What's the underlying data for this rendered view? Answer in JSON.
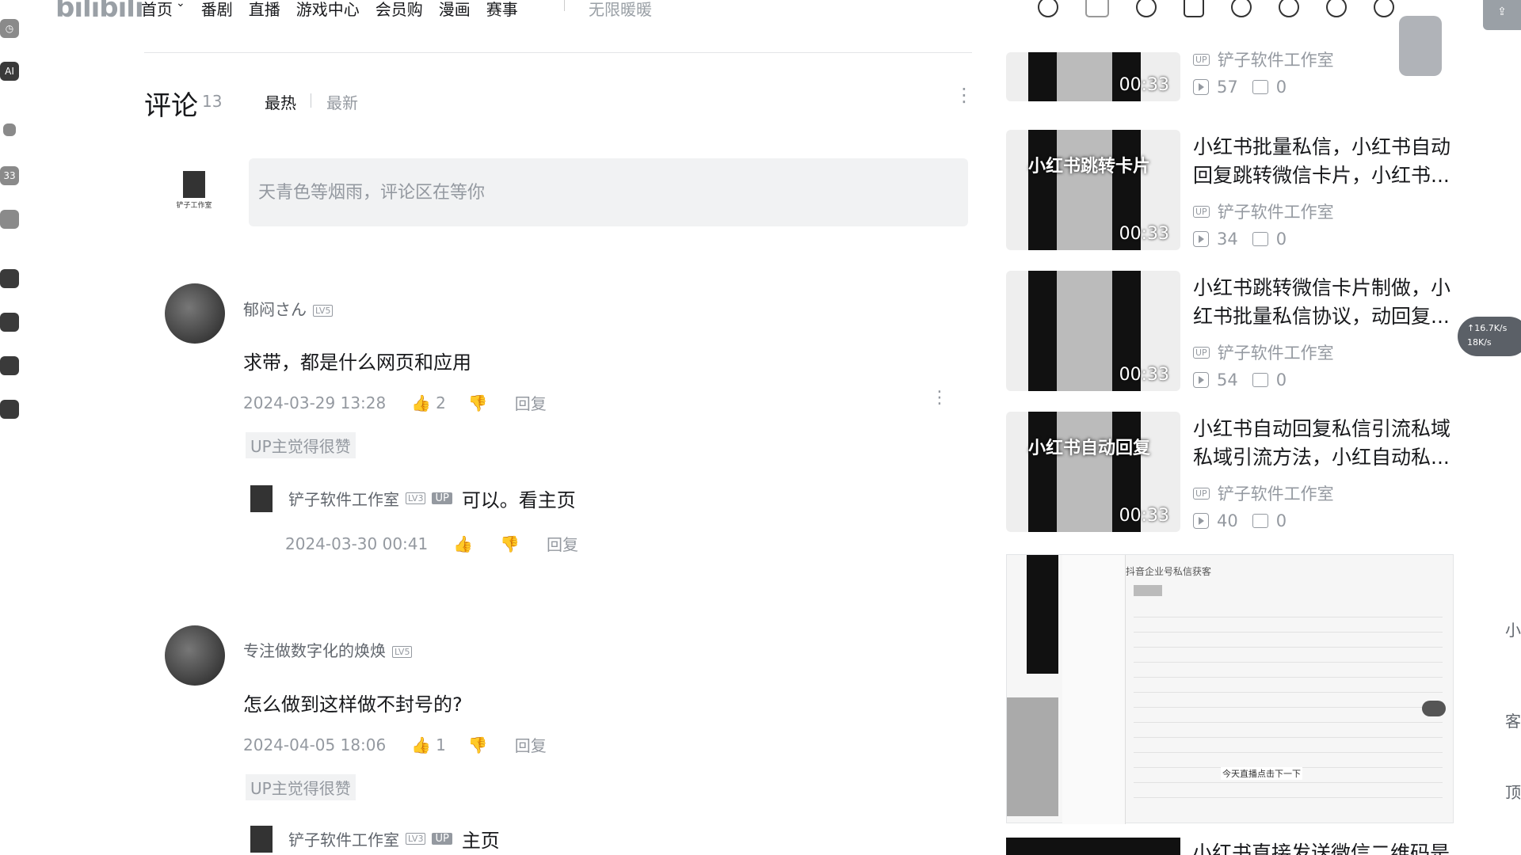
{
  "nav": {
    "logo": "bilibili",
    "items": [
      "首页",
      "番剧",
      "直播",
      "游戏中心",
      "会员购",
      "漫画",
      "赛事"
    ],
    "search_hint": "无限暖暖"
  },
  "left_strip": {
    "ai_label": "AI",
    "badge": "33"
  },
  "comments": {
    "title": "评论",
    "count": "13",
    "sort_hot": "最热",
    "sort_new": "最新",
    "input_placeholder": "天青色等烟雨，评论区在等你",
    "self_avatar_caption": "铲子工作室",
    "items": [
      {
        "user": "郁闷さん",
        "level": "LV5",
        "text": "求带，都是什么网页和应用",
        "time": "2024-03-29 13:28",
        "likes": "2",
        "reply_label": "回复",
        "up_liked": "UP主觉得很赞",
        "reply": {
          "user": "铲子软件工作室",
          "level": "LV3",
          "up": "UP",
          "text": "可以。看主页",
          "time": "2024-03-30 00:41",
          "reply_label": "回复"
        }
      },
      {
        "user": "专注做数字化的焕焕",
        "level": "LV5",
        "text": "怎么做到这样做不封号的?",
        "time": "2024-04-05 18:06",
        "likes": "1",
        "reply_label": "回复",
        "up_liked": "UP主觉得很赞",
        "reply": {
          "user": "铲子软件工作室",
          "level": "LV3",
          "up": "UP",
          "text": "主页"
        }
      }
    ]
  },
  "videos": [
    {
      "title": "",
      "author": "铲子软件工作室",
      "plays": "57",
      "danmaku": "0",
      "duration": "00:33",
      "overlay": ""
    },
    {
      "title": "小红书批量私信，小红书自动回复跳转微信卡片，小红书...",
      "author": "铲子软件工作室",
      "plays": "34",
      "danmaku": "0",
      "duration": "00:33",
      "overlay": "小红书跳转卡片"
    },
    {
      "title": "小红书跳转微信卡片制做，小红书批量私信协议，动回复...",
      "author": "铲子软件工作室",
      "plays": "54",
      "danmaku": "0",
      "duration": "00:33",
      "overlay": ""
    },
    {
      "title": "小红书自动回复私信引流私域私域引流方法，小红自动私...",
      "author": "铲子软件工作室",
      "plays": "40",
      "danmaku": "0",
      "duration": "00:33",
      "overlay": "小红书自动回复"
    }
  ],
  "big_thumb": {
    "header": "抖音企业号私信获客",
    "caption": "今天直播点击下一下"
  },
  "partial_title": "小红书直接发送微信二维码是",
  "speed": {
    "up": "↑16.7K/s",
    "down": "18K/s"
  },
  "edge": {
    "a": "小",
    "b": "客",
    "c": "顶"
  },
  "up_badge": "UP"
}
